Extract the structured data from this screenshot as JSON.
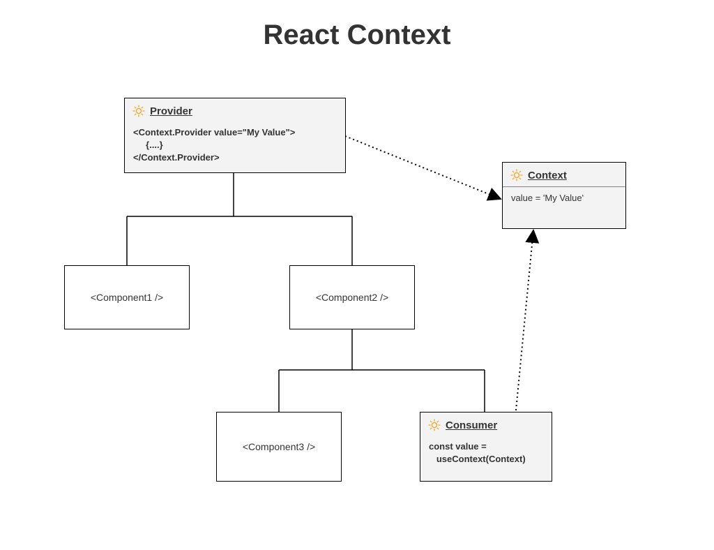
{
  "title": "React Context",
  "provider": {
    "label": "Provider",
    "code_line1": "<Context.Provider value=\"My Value\">",
    "code_line2": "     {....}",
    "code_line3": "</Context.Provider>"
  },
  "context": {
    "label": "Context",
    "body": "value = 'My Value'"
  },
  "consumer": {
    "label": "Consumer",
    "code_line1": "const value =",
    "code_line2": "   useContext(Context)"
  },
  "components": {
    "c1": "<Component1 />",
    "c2": "<Component2 />",
    "c3": "<Component3 />"
  },
  "diagram": {
    "nodes": [
      {
        "id": "provider",
        "type": "provider",
        "label": "Provider",
        "code": "<Context.Provider value=\"My Value\"> {....} </Context.Provider>"
      },
      {
        "id": "context",
        "type": "context",
        "label": "Context",
        "value": "value = 'My Value'"
      },
      {
        "id": "component1",
        "type": "component",
        "label": "<Component1 />"
      },
      {
        "id": "component2",
        "type": "component",
        "label": "<Component2 />"
      },
      {
        "id": "component3",
        "type": "component",
        "label": "<Component3 />"
      },
      {
        "id": "consumer",
        "type": "consumer",
        "label": "Consumer",
        "code": "const value = useContext(Context)"
      }
    ],
    "tree_edges": [
      {
        "from": "provider",
        "to": "component1"
      },
      {
        "from": "provider",
        "to": "component2"
      },
      {
        "from": "component2",
        "to": "component3"
      },
      {
        "from": "component2",
        "to": "consumer"
      }
    ],
    "context_edges": [
      {
        "from": "provider",
        "to": "context",
        "style": "dotted-arrow"
      },
      {
        "from": "consumer",
        "to": "context",
        "style": "dotted-arrow"
      }
    ]
  },
  "colors": {
    "gear": "#f5a623",
    "shaded_box": "#f3f3f3",
    "text": "#333333"
  }
}
